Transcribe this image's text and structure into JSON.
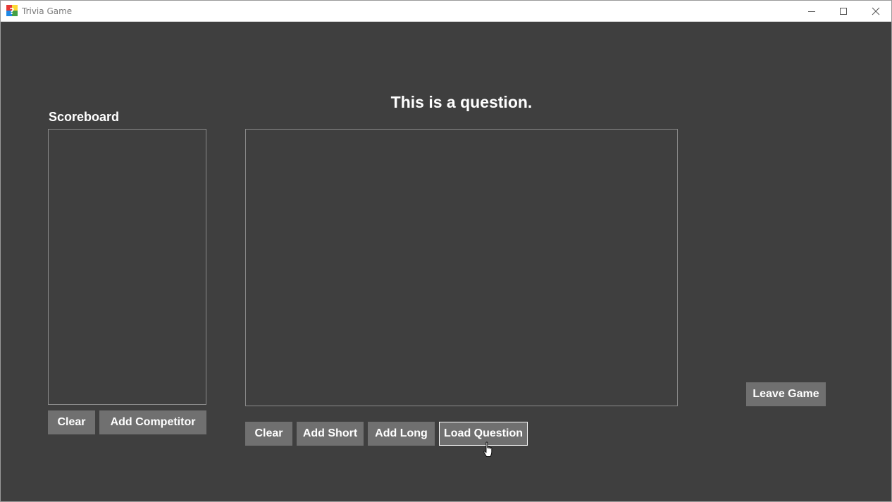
{
  "window": {
    "title": "Trivia Game"
  },
  "question": {
    "text": "This is a question."
  },
  "scoreboard": {
    "label": "Scoreboard",
    "clear_label": "Clear",
    "add_competitor_label": "Add Competitor"
  },
  "answers": {
    "clear_label": "Clear",
    "add_short_label": "Add Short",
    "add_long_label": "Add Long",
    "load_question_label": "Load Question"
  },
  "leave_game_label": "Leave Game",
  "colors": {
    "background": "#3f3f3f",
    "button": "#707070",
    "text": "#ffffff",
    "panel_border": "#8a8a8a"
  },
  "icons": {
    "app": "trivia-app-icon",
    "minimize": "minimize-icon",
    "maximize": "maximize-icon",
    "close": "close-icon",
    "cursor": "hand-cursor-icon"
  }
}
